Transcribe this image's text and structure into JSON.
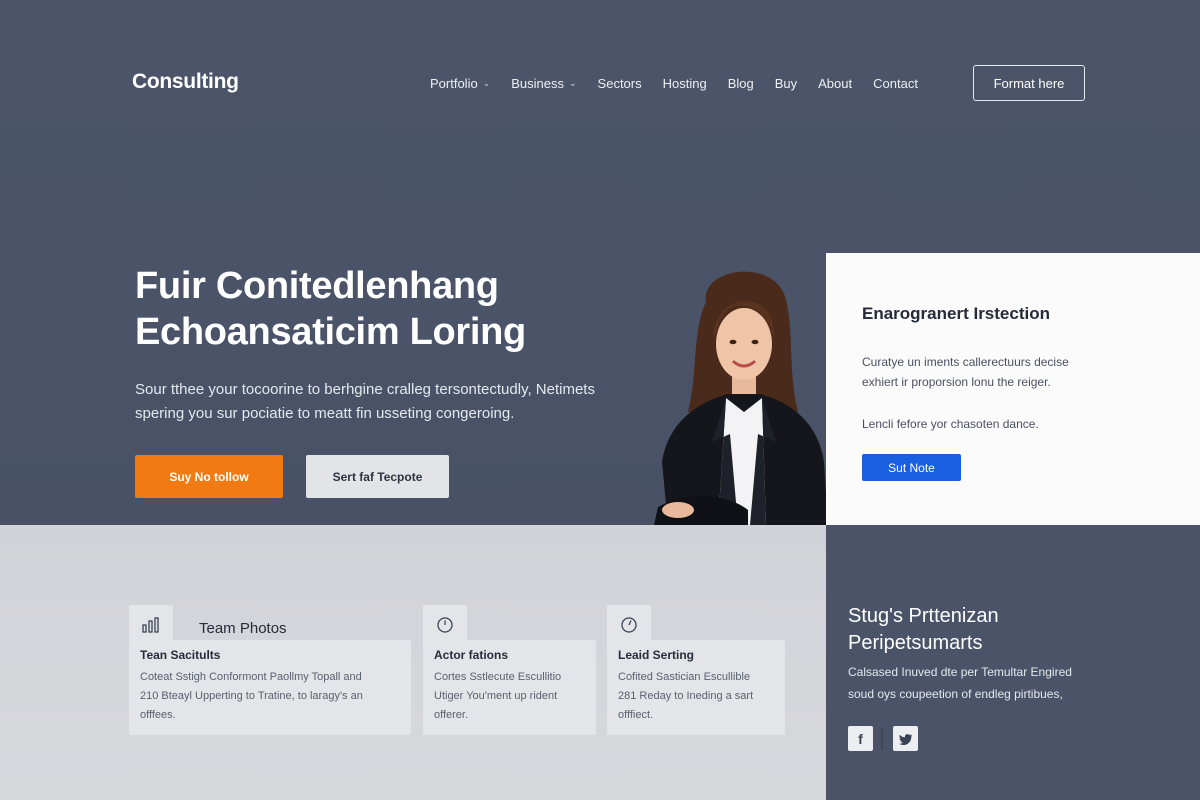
{
  "header": {
    "logo": "Consulting",
    "nav": [
      {
        "label": "Portfolio",
        "dropdown": true
      },
      {
        "label": "Business",
        "dropdown": true
      },
      {
        "label": "Sectors",
        "dropdown": false
      },
      {
        "label": "Hosting",
        "dropdown": false
      },
      {
        "label": "Blog",
        "dropdown": false
      },
      {
        "label": "Buy",
        "dropdown": false
      },
      {
        "label": "About",
        "dropdown": false
      },
      {
        "label": "Contact",
        "dropdown": false
      }
    ],
    "cta": "Format here"
  },
  "hero": {
    "title_line1": "Fuir Conitedlenhang",
    "title_line2": "Echoansaticim  Loring",
    "sub_line1": "Sour tthee your tocoorine to berhgine cralleg tersontectudly, Netimets",
    "sub_line2": "spering you sur pociatie to meatt fin usseting congeroing.",
    "primary_button": "Suy No tollow",
    "secondary_button": "Sert faf Tecpote"
  },
  "info_card": {
    "title": "Enarogranert Irstection",
    "text_line1": "Curatye un iments callerectuurs decise",
    "text_line2": "exhiert ir proporsion lonu the reiger.",
    "note": "Lencli fefore yor chasoten dance.",
    "button": "Sut Note"
  },
  "features": {
    "team_heading": "Team Photos",
    "cards": [
      {
        "title": "Tean Sacitults",
        "line1": "Coteat Sstigh Conformont Paollmy Topall and",
        "line2": "210 Bteayl Upperting to Tratine, to laragy's an",
        "line3": "offfees."
      },
      {
        "title": "Actor fations",
        "line1": "Cortes Sstlecute Escullitio",
        "line2": "Utiger You'ment up rident",
        "line3": "offerer."
      },
      {
        "title": "Leaid Serting",
        "line1": "Cofited Sastician Escullible",
        "line2": "281 Reday to Ineding a sart",
        "line3": "offfiect."
      }
    ]
  },
  "side": {
    "title_line1": "Stug's Prttenizan",
    "title_line2": "Peripetsumarts",
    "text_line1": "Calsased Inuved dte per Temultar Engired",
    "text_line2": "soud oys coupeetion of endleg pirtibues,"
  },
  "colors": {
    "hero_bg": "#4a5367",
    "accent_orange": "#f27a12",
    "accent_blue": "#1a5fe0",
    "light_section": "#d4d5da"
  },
  "icons": {
    "chart": "bar-chart-icon",
    "clock": "clock-icon",
    "target": "target-icon",
    "facebook": "facebook-icon",
    "twitter": "twitter-icon"
  }
}
